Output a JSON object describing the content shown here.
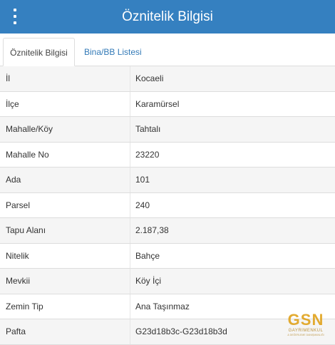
{
  "header": {
    "title": "Öznitelik Bilgisi",
    "menu_icon": "vertical-ellipsis-icon"
  },
  "tabs": [
    {
      "label": "Öznitelik Bilgisi",
      "active": true
    },
    {
      "label": "Bina/BB Listesi",
      "active": false
    }
  ],
  "attributes": [
    {
      "key": "İl",
      "value": "Kocaeli"
    },
    {
      "key": "İlçe",
      "value": "Karamürsel"
    },
    {
      "key": "Mahalle/Köy",
      "value": "Tahtalı"
    },
    {
      "key": "Mahalle No",
      "value": "23220"
    },
    {
      "key": "Ada",
      "value": "101"
    },
    {
      "key": "Parsel",
      "value": "240"
    },
    {
      "key": "Tapu Alanı",
      "value": "2.187,38"
    },
    {
      "key": "Nitelik",
      "value": "Bahçe"
    },
    {
      "key": "Mevkii",
      "value": "Köy İçi"
    },
    {
      "key": "Zemin Tip",
      "value": "Ana Taşınmaz"
    },
    {
      "key": "Pafta",
      "value": "G23d18b3c-G23d18b3d"
    }
  ],
  "logo": {
    "mark": "GSN",
    "sub": "GAYRİMENKUL",
    "sub2": "& DEĞERLEME DANIŞMANLIĞI"
  },
  "colors": {
    "header_bg": "#3580c0",
    "link": "#337ab7",
    "logo": "#e0a21b"
  }
}
